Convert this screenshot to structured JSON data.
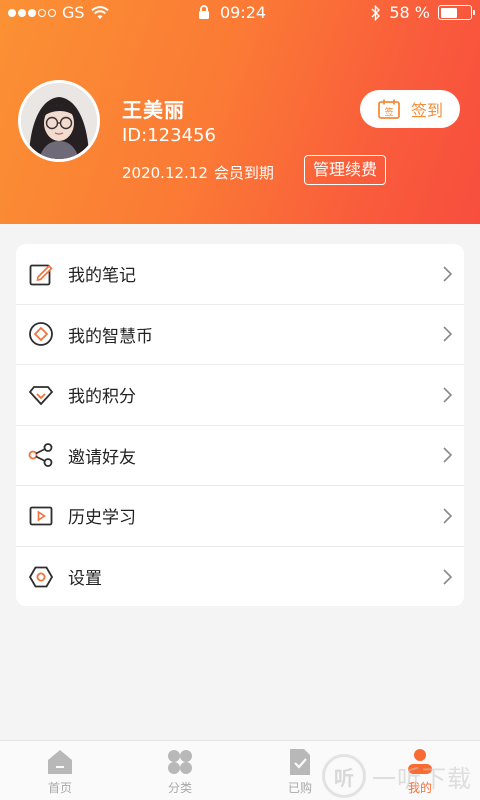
{
  "status_bar": {
    "carrier": "GS",
    "time": "09:24",
    "battery_percent": "58 %",
    "battery_level": 0.58
  },
  "profile": {
    "name": "王美丽",
    "id_text": "ID:123456",
    "expire_date": "2020.12.12",
    "expire_label": "会员到期",
    "renew_label": "管理续费",
    "checkin_label": "签到",
    "checkin_icon_text": "签"
  },
  "menu": {
    "items": [
      {
        "label": "我的笔记",
        "icon": "note-edit-icon"
      },
      {
        "label": "我的智慧币",
        "icon": "coin-icon"
      },
      {
        "label": "我的积分",
        "icon": "diamond-icon"
      },
      {
        "label": "邀请好友",
        "icon": "share-icon"
      },
      {
        "label": "历史学习",
        "icon": "play-history-icon"
      },
      {
        "label": "设置",
        "icon": "settings-hexagon-icon"
      }
    ]
  },
  "tabbar": {
    "tabs": [
      {
        "label": "首页",
        "icon": "home-icon",
        "active": false
      },
      {
        "label": "分类",
        "icon": "category-icon",
        "active": false
      },
      {
        "label": "已购",
        "icon": "purchased-icon",
        "active": false
      },
      {
        "label": "我的",
        "icon": "profile-icon",
        "active": true
      }
    ]
  },
  "watermark": {
    "circle_text": "听",
    "text": "一听下载"
  },
  "colors": {
    "accent": "#f86c33",
    "header_start": "#fb9134",
    "header_end": "#f84e3e",
    "icon_orange": "#f5703a"
  }
}
